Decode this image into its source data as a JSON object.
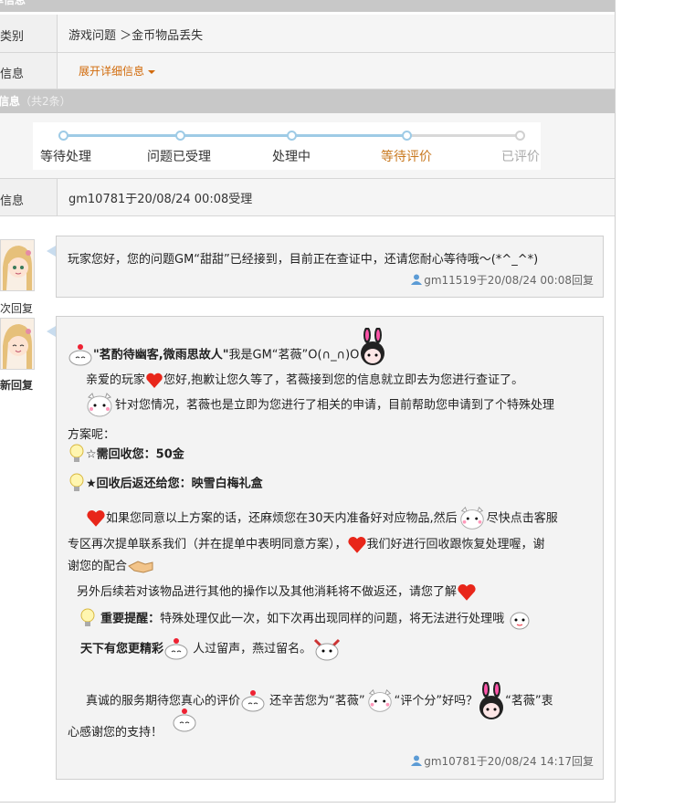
{
  "sections": {
    "order_info_label": "提单信息",
    "reply_info_label": "回复信息",
    "reply_count": "（共2条）"
  },
  "rows": {
    "category_label": "问题类别",
    "category_value": "游戏问题 ＞金币物品丢失",
    "info_label": "问题信息",
    "info_link": "展开详细信息",
    "reply_label": "回复信息",
    "reply_value": "gm10781于20/08/24 00:08受理"
  },
  "progress": {
    "steps": [
      "等待处理",
      "问题已受理",
      "处理中",
      "等待评价",
      "已评价"
    ],
    "current_step": "等待评价"
  },
  "colors": {
    "accent": "#d16a0a",
    "progress_done": "#9ecbe6",
    "progress_todo": "#d0d0d0",
    "header_bg": "#c8c8c8"
  },
  "replies": [
    {
      "avatar_label": "首次回复",
      "text": "玩家您好，您的问题GM“甜甜”已经接到，目前正在查证中，还请您耐心等待哦～(*^_^*)",
      "meta": "gm11519于20/08/24 00:08回复"
    },
    {
      "avatar_label": "最新回复",
      "title_bold": "\"茗酌待幽客,微雨思故人\"",
      "title_rest": "我是GM“茗薇”O(∩_∩)O",
      "greeting": "亲爱的玩家",
      "greeting_rest": "您好,抱歉让您久等了，茗薇接到您的信息就立即去为您进行查证了。",
      "para2_a": "针对您情况，茗薇也是立即为您进行了相关的申请，目前帮助您申请到了个特殊处理",
      "para2_b": "方案呢：",
      "item1": "☆需回收您：50金",
      "item2": "★回收后返还给您：映雪白梅礼盒",
      "para3_a": "如果您同意以上方案的话，还麻烦您在30天内准备好对应物品,然后",
      "para3_a2": "尽快点击客服",
      "para3_b": "专区再次提单联系我们（并在提单中表明同意方案），",
      "para3_b2": "我们好进行回收跟恢复处理喔，谢",
      "para3_c": "谢您的配合",
      "para4": "另外后续若对该物品进行其他的操作以及其他消耗将不做返还，请您了解",
      "important_bold": "重要提醒：",
      "important_rest": "特殊处理仅此一次，如下次再出现同样的问题，将无法进行处理哦",
      "wonder_bold": "天下有您更精彩",
      "wonder_rest": "人过留声，燕过留名。",
      "closing_a": "真诚的服务期待您真心的评价",
      "closing_b": "还辛苦您为“茗薇”",
      "closing_c": "“评个分”好吗？",
      "closing_d": "“茗薇”衷",
      "closing_e": "心感谢您的支持！",
      "meta": "gm10781于20/08/24 14:17回复"
    }
  ],
  "icons": [
    "user-icon",
    "heart-icon",
    "bulb-icon",
    "bunny-icon",
    "cat-icon",
    "cloud-face-icon",
    "handshake-icon"
  ]
}
